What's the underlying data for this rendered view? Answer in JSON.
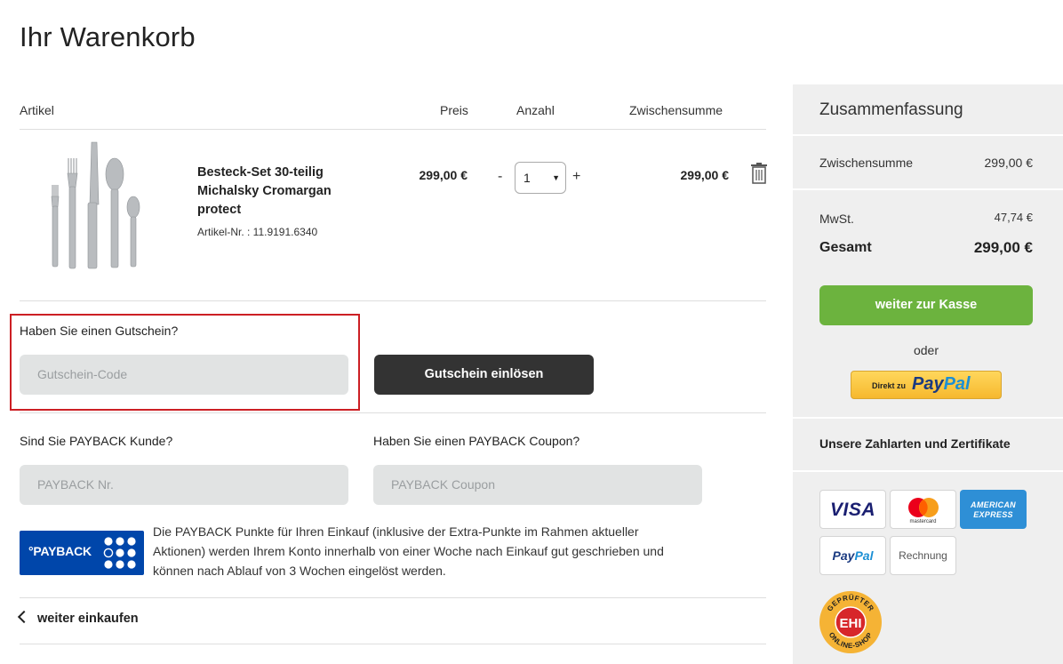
{
  "page": {
    "title": "Ihr Warenkorb"
  },
  "cart": {
    "headers": {
      "article": "Artikel",
      "price": "Preis",
      "quantity": "Anzahl",
      "subtotal": "Zwischensumme"
    },
    "item": {
      "name": "Besteck-Set 30-teilig Michalsky Cromargan protect",
      "sku": "Artikel-Nr. : 11.9191.6340",
      "price": "299,00 €",
      "quantity": "1",
      "minus": "-",
      "plus": "+",
      "subtotal": "299,00 €"
    }
  },
  "voucher": {
    "question": "Haben Sie einen Gutschein?",
    "placeholder": "Gutschein-Code",
    "button": "Gutschein einlösen"
  },
  "payback": {
    "customer_question": "Sind Sie PAYBACK Kunde?",
    "customer_placeholder": "PAYBACK Nr.",
    "coupon_question": "Haben Sie einen PAYBACK Coupon?",
    "coupon_placeholder": "PAYBACK Coupon",
    "logo_text": "°PAYBACK",
    "info": "Die PAYBACK Punkte für Ihren Einkauf (inklusive der Extra-Punkte im Rahmen aktueller Aktionen) werden Ihrem Konto innerhalb von einer Woche nach Einkauf gut geschrieben und können nach Ablauf von 3 Wochen eingelöst werden."
  },
  "navigation": {
    "continue_shopping": "weiter einkaufen"
  },
  "summary": {
    "title": "Zusammenfassung",
    "subtotal_label": "Zwischensumme",
    "subtotal_value": "299,00 €",
    "tax_label": "MwSt.",
    "tax_value": "47,74 €",
    "total_label": "Gesamt",
    "total_value": "299,00 €",
    "checkout_button": "weiter zur Kasse",
    "or_text": "oder",
    "paypal_prefix": "Direkt zu",
    "paypal_brand_1": "Pay",
    "paypal_brand_2": "Pal",
    "payments_title": "Unsere Zahlarten und Zertifikate",
    "payment_methods": {
      "visa": "VISA",
      "mastercard": "mastercard",
      "amex_1": "AMERICAN",
      "amex_2": "EXPRESS",
      "paypal_1": "Pay",
      "paypal_2": "Pal",
      "invoice": "Rechnung"
    },
    "certificate": {
      "center": "EHI",
      "ring": "GEPRÜFTER ONLINE-SHOP"
    }
  },
  "colors": {
    "checkout_green": "#6cb33e",
    "dark_button": "#333333",
    "payback_blue": "#0046aa",
    "highlight_red": "#cc1f24",
    "sidebar_bg": "#efefef",
    "input_bg": "#e1e3e3"
  },
  "icons": [
    "trash-icon",
    "chevron-left-icon",
    "dropdown-arrow-icon"
  ]
}
